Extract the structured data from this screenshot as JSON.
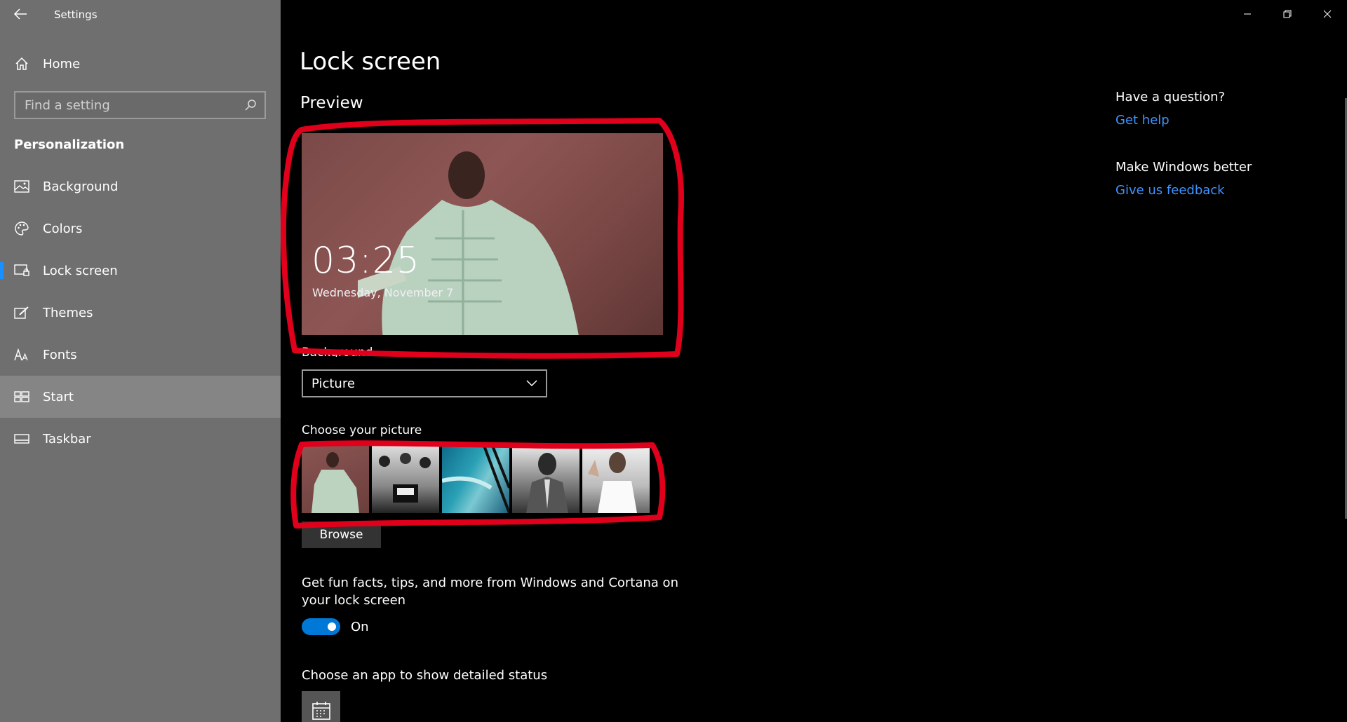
{
  "window": {
    "title": "Settings"
  },
  "sidebar": {
    "home_label": "Home",
    "search_placeholder": "Find a setting",
    "section_title": "Personalization",
    "items": [
      {
        "label": "Background",
        "icon": "picture-icon"
      },
      {
        "label": "Colors",
        "icon": "palette-icon"
      },
      {
        "label": "Lock screen",
        "icon": "lock-screen-icon",
        "selected": true
      },
      {
        "label": "Themes",
        "icon": "themes-icon"
      },
      {
        "label": "Fonts",
        "icon": "fonts-icon"
      },
      {
        "label": "Start",
        "icon": "start-icon",
        "hover": true
      },
      {
        "label": "Taskbar",
        "icon": "taskbar-icon"
      }
    ]
  },
  "main": {
    "page_title": "Lock screen",
    "preview_label": "Preview",
    "preview_time": "03:25",
    "preview_date": "Wednesday, November 7",
    "background_label": "Background",
    "background_value": "Picture",
    "choose_picture_label": "Choose your picture",
    "browse_label": "Browse",
    "tips_text": "Get fun facts, tips, and more from Windows and Cortana on your lock screen",
    "tips_toggle_state": "On",
    "detailed_status_label": "Choose an app to show detailed status"
  },
  "right_column": {
    "question_heading": "Have a question?",
    "get_help": "Get help",
    "better_heading": "Make Windows better",
    "feedback": "Give us feedback"
  },
  "colors": {
    "accent": "#0078d7",
    "link": "#3f93ff",
    "annotation": "#e0001b"
  }
}
